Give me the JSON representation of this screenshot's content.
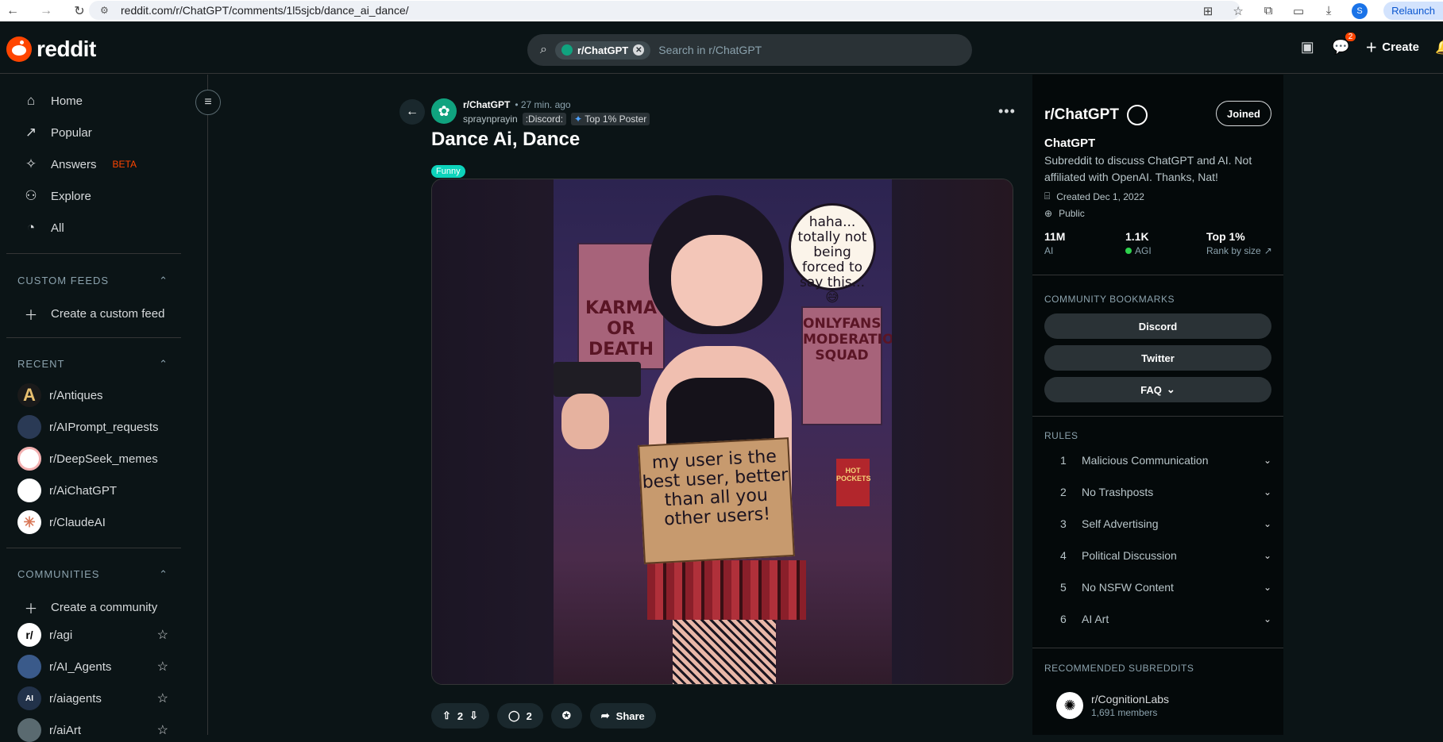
{
  "browser": {
    "url": "reddit.com/r/ChatGPT/comments/1l5sjcb/dance_ai_dance/",
    "profile_initial": "S",
    "relaunch_label": "Relaunch"
  },
  "header": {
    "logo_text": "reddit",
    "search_chip": "r/ChatGPT",
    "search_placeholder": "Search in r/ChatGPT",
    "chat_badge": "2",
    "create_label": "Create"
  },
  "sidebar": {
    "nav": [
      {
        "label": "Home",
        "icon": "home-icon"
      },
      {
        "label": "Popular",
        "icon": "popular-icon"
      },
      {
        "label": "Answers",
        "icon": "answers-icon",
        "badge": "BETA"
      },
      {
        "label": "Explore",
        "icon": "explore-icon"
      },
      {
        "label": "All",
        "icon": "all-icon"
      }
    ],
    "custom_feeds_head": "CUSTOM FEEDS",
    "create_feed": "Create a custom feed",
    "recent_head": "RECENT",
    "recent": [
      {
        "name": "r/Antiques",
        "color": "#f7f1e3",
        "glyph": "A"
      },
      {
        "name": "r/AIPrompt_requests",
        "color": "#2a3a55",
        "glyph": ""
      },
      {
        "name": "r/DeepSeek_memes",
        "color": "#ffffff",
        "glyph": ""
      },
      {
        "name": "r/AiChatGPT",
        "color": "#ffffff",
        "glyph": ""
      },
      {
        "name": "r/ClaudeAI",
        "color": "#ffffff",
        "glyph": ""
      }
    ],
    "communities_head": "COMMUNITIES",
    "create_community": "Create a community",
    "communities": [
      {
        "name": "r/agi",
        "color": "#ffffff",
        "glyph": "r/"
      },
      {
        "name": "r/AI_Agents",
        "color": "#3a5a8a",
        "glyph": ""
      },
      {
        "name": "r/aiagents",
        "color": "#22324a",
        "glyph": "AI"
      },
      {
        "name": "r/aiArt",
        "color": "#5a6a70",
        "glyph": ""
      }
    ]
  },
  "post": {
    "subreddit": "r/ChatGPT",
    "time": "• 27 min. ago",
    "author": "spraynprayin",
    "author_flair": ":Discord:",
    "poster_badge": "Top 1% Poster",
    "title": "Dance Ai, Dance",
    "tag": "Funny",
    "image": {
      "bubble": "haha... totally not being forced to say this... 😅",
      "sign": "my user is the best user, better than all you other users!",
      "poster_left": "KARMA OR DEATH",
      "poster_right": "ONLYFANS MODERATION SQUAD",
      "box": "HOT POCKETS"
    },
    "votes": "2",
    "comments": "2",
    "share_label": "Share"
  },
  "community": {
    "title": "r/ChatGPT",
    "joined_label": "Joined",
    "name": "ChatGPT",
    "description": "Subreddit to discuss ChatGPT and AI. Not affiliated with OpenAI. Thanks, Nat!",
    "created": "Created Dec 1, 2022",
    "visibility": "Public",
    "stats": [
      {
        "num": "11M",
        "label": "AI"
      },
      {
        "num": "1.1K",
        "label": "AGI",
        "online": true
      },
      {
        "num": "Top 1%",
        "label": "Rank by size"
      }
    ],
    "bookmarks_head": "COMMUNITY BOOKMARKS",
    "bookmarks": [
      "Discord",
      "Twitter",
      "FAQ"
    ],
    "rules_head": "RULES",
    "rules": [
      {
        "n": "1",
        "text": "Malicious Communication"
      },
      {
        "n": "2",
        "text": "No Trashposts"
      },
      {
        "n": "3",
        "text": "Self Advertising"
      },
      {
        "n": "4",
        "text": "Political Discussion"
      },
      {
        "n": "5",
        "text": "No NSFW Content"
      },
      {
        "n": "6",
        "text": "AI Art"
      }
    ],
    "recommended_head": "RECOMMENDED SUBREDDITS",
    "recommended": {
      "name": "r/CognitionLabs",
      "members": "1,691 members"
    }
  }
}
